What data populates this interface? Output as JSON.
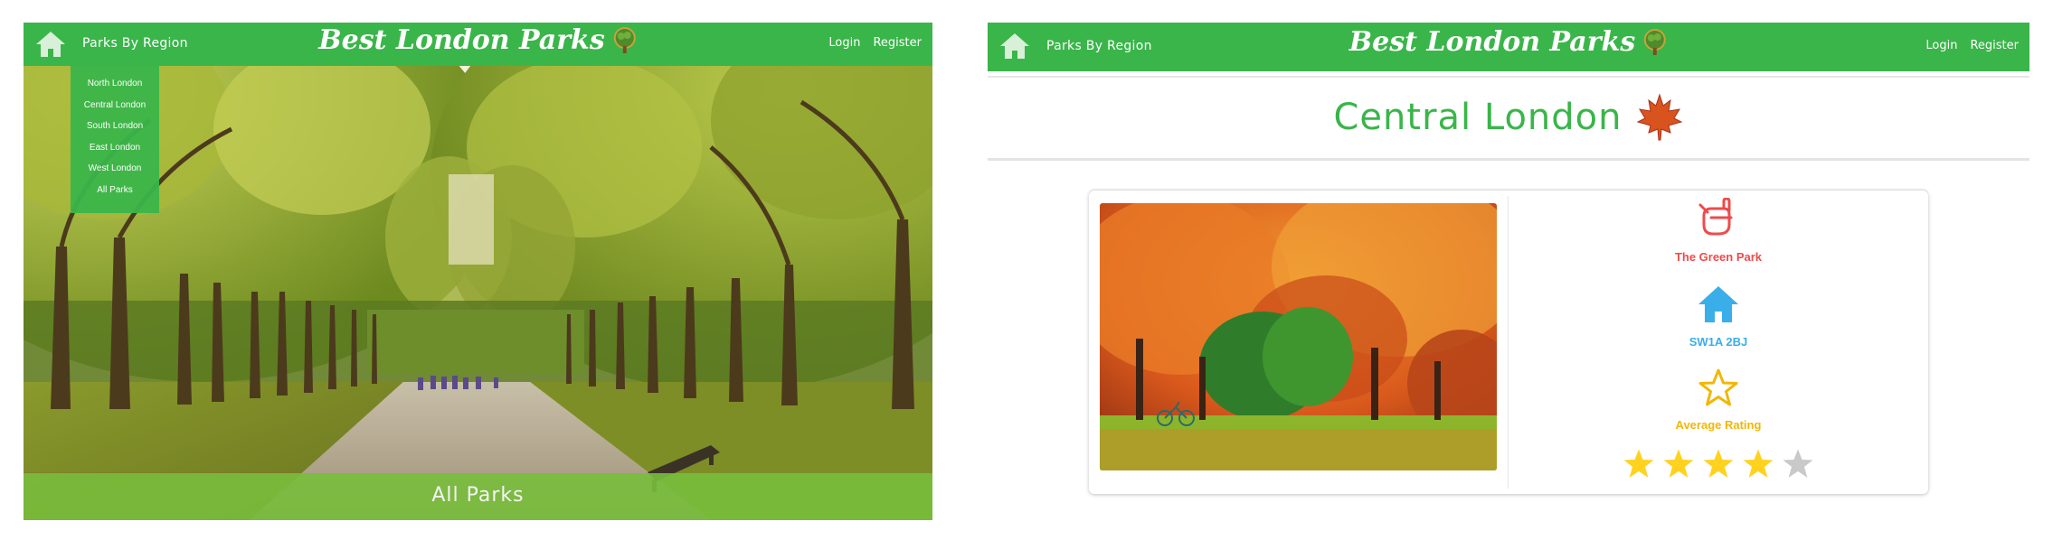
{
  "nav": {
    "region_label": "Parks By Region",
    "brand": "Best London Parks",
    "login": "Login",
    "register": "Register"
  },
  "left": {
    "dropdown_items": [
      "North London",
      "Central London",
      "South London",
      "East London",
      "West London",
      "All Parks"
    ],
    "hero_caption": "All Parks"
  },
  "right": {
    "region_title": "Central London",
    "park": {
      "name": "The Green Park",
      "postcode": "SW1A 2BJ",
      "rating_label": "Average Rating",
      "rating_stars": 4,
      "rating_max": 5
    }
  },
  "colors": {
    "brand_green": "#3ab54a",
    "park_name_red": "#ee4b4b",
    "postcode_blue": "#3aaee8",
    "rating_gold": "#f2b705",
    "star_fill": "#ffd21f",
    "star_empty": "#c9c9c9"
  }
}
